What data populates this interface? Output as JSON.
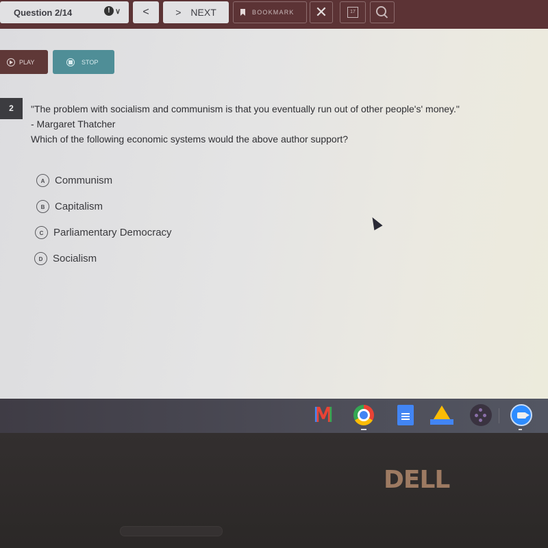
{
  "toolbar": {
    "question_label": "Question 2/14",
    "flag_glyph": "!",
    "flag_chevron": "∨",
    "prev_glyph": "<",
    "next_glyph": ">",
    "next_label": "NEXT",
    "bookmark_label": "BOOKMARK",
    "close_glyph": "✕",
    "calendar_glyph": "17"
  },
  "audio": {
    "play_label": "PLAY",
    "stop_label": "STOP",
    "play_color": "#5f3837",
    "stop_color": "#4f8e97"
  },
  "question": {
    "number": "2",
    "quote": "\"The problem with socialism and communism is that you eventually run out of other people's' money.\"",
    "attribution": "- Margaret Thatcher",
    "prompt": "Which of the following economic systems would the above author support?"
  },
  "options": [
    {
      "letter": "A",
      "label": "Communism"
    },
    {
      "letter": "B",
      "label": "Capitalism"
    },
    {
      "letter": "C",
      "label": "Parliamentary Democracy"
    },
    {
      "letter": "D",
      "label": "Socialism"
    }
  ],
  "shelf": {
    "apps": [
      "Gmail",
      "Chrome",
      "Docs",
      "Drive",
      "Launcher",
      "Zoom"
    ],
    "gmail_glyph": "M"
  },
  "device": {
    "brand": "DELL"
  }
}
